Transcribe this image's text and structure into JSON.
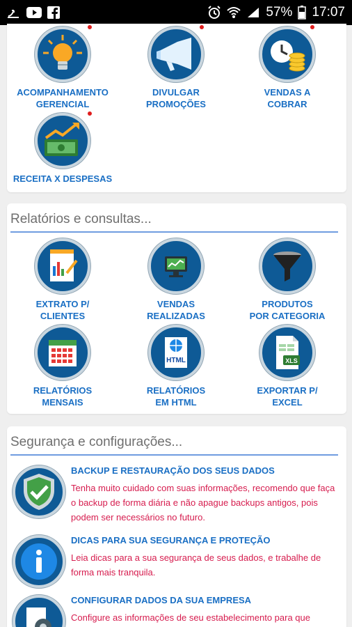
{
  "status_bar": {
    "battery_percent": "57%",
    "time": "17:07",
    "left_icons": [
      "upload-icon",
      "youtube-icon",
      "facebook-icon"
    ],
    "right_icons": [
      "alarm-icon",
      "wifi-icon",
      "signal-icon",
      "battery-icon"
    ]
  },
  "colors": {
    "label_blue": "#1a6fc4",
    "desc_pink": "#d61c4e",
    "icon_bg": "#0e5a96",
    "rule_blue": "#6f9ce0"
  },
  "section_top": {
    "tiles": [
      {
        "label_line1": "ACOMPANHAMENTO",
        "label_line2": "GERENCIAL",
        "icon": "lightbulb-icon"
      },
      {
        "label_line1": "DIVULGAR",
        "label_line2": "PROMOÇÕES",
        "icon": "megaphone-icon"
      },
      {
        "label_line1": "VENDAS A",
        "label_line2": "COBRAR",
        "icon": "clock-coins-icon"
      },
      {
        "label_line1": "RECEITA X DESPESAS",
        "label_line2": "",
        "icon": "money-chart-icon"
      }
    ]
  },
  "section_reports": {
    "title": "Relatórios e consultas...",
    "tiles": [
      {
        "label_line1": "EXTRATO P/",
        "label_line2": "CLIENTES",
        "icon": "report-chart-icon"
      },
      {
        "label_line1": "VENDAS",
        "label_line2": "REALIZADAS",
        "icon": "monitor-sales-icon"
      },
      {
        "label_line1": "PRODUTOS",
        "label_line2": "POR CATEGORIA",
        "icon": "funnel-icon"
      },
      {
        "label_line1": "RELATÓRIOS",
        "label_line2": "MENSAIS",
        "icon": "calendar-icon"
      },
      {
        "label_line1": "RELATÓRIOS",
        "label_line2": "EM HTML",
        "icon": "html-globe-icon"
      },
      {
        "label_line1": "EXPORTAR P/",
        "label_line2": "EXCEL",
        "icon": "xls-file-icon"
      }
    ]
  },
  "section_security": {
    "title": "Segurança e configurações...",
    "items": [
      {
        "title": "BACKUP E RESTAURAÇÃO DOS SEUS DADOS",
        "desc": "Tenha muito cuidado com suas informações, recomendo que faça o backup de forma diária e não apague backups antigos, pois podem ser necessários no futuro.",
        "icon": "shield-check-icon"
      },
      {
        "title": "DICAS PARA SUA SEGURANÇA E PROTEÇÃO",
        "desc": "Leia dicas para a sua segurança de seus dados, e trabalhe de forma mais tranquila.",
        "icon": "info-icon"
      },
      {
        "title": "CONFIGURAR DADOS DA SUA EMPRESA",
        "desc": "Configure as informações de seu estabelecimento para que",
        "icon": "settings-gear-icon"
      }
    ]
  }
}
